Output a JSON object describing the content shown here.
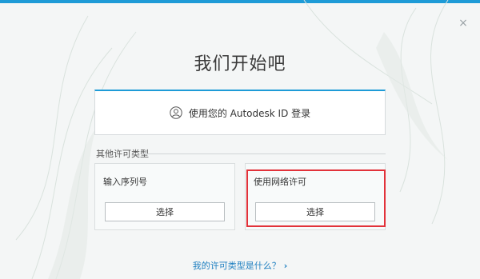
{
  "window": {
    "close_glyph": "×",
    "accent": "#1e9bd7"
  },
  "header": {
    "title": "我们开始吧"
  },
  "signin": {
    "icon": "user-icon",
    "label": "使用您的 Autodesk ID 登录"
  },
  "other_license": {
    "section_label": "其他许可类型",
    "options": [
      {
        "label": "输入序列号",
        "button": "选择"
      },
      {
        "label": "使用网络许可",
        "button": "选择"
      }
    ]
  },
  "footer": {
    "link": "我的许可类型是什么？",
    "link_icon": "chevron-right-icon",
    "link_color": "#1e7fc0"
  },
  "highlight_color": "#e2323a"
}
